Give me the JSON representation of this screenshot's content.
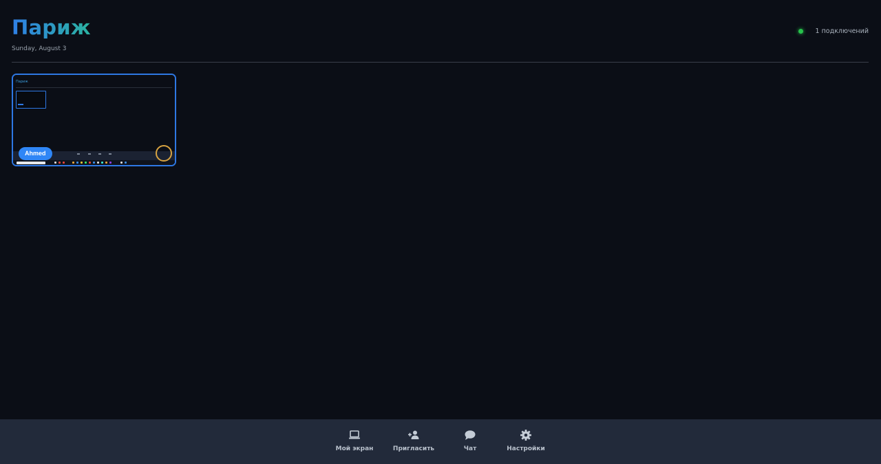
{
  "header": {
    "title": "Париж",
    "date": "Sunday, August 3",
    "connections": "1 подключений",
    "status_color": "#27c24c"
  },
  "tile": {
    "participant_name": "Ahmed",
    "border_color": "#2e78e4",
    "pill_color": "#2f86f6",
    "ring_color": "#d9a441",
    "thumbnail": {
      "title": "Париж"
    }
  },
  "toolbar": {
    "my_screen_label": "Мой экран",
    "my_screen_icon": "laptop-icon",
    "invite_label": "Пригласить",
    "invite_icon": "user-plus-icon",
    "chat_label": "Чат",
    "chat_icon": "chat-bubble-icon",
    "settings_label": "Настройки",
    "settings_icon": "gear-icon"
  }
}
